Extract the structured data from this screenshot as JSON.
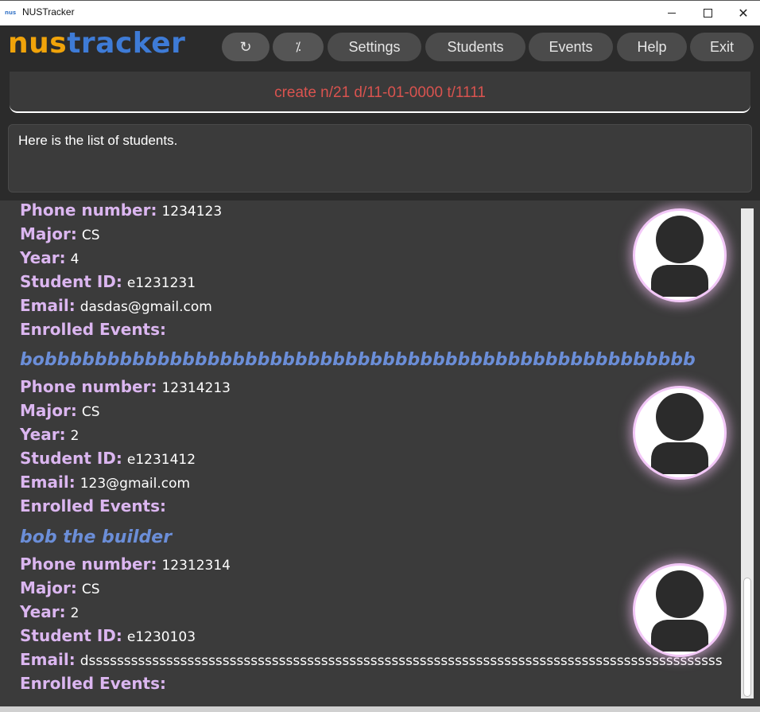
{
  "window": {
    "title": "NUSTracker",
    "icon": "nustracker-app-icon",
    "close_glyph": "✕"
  },
  "header": {
    "logo_part1": "nus",
    "logo_part2": "tracker",
    "buttons": {
      "refresh_icon": "↻",
      "percent_icon": "⁒",
      "settings": "Settings",
      "students": "Students",
      "events": "Events",
      "help": "Help",
      "exit": "Exit"
    }
  },
  "command": {
    "value": "create n/21 d/11-01-0000 t/1111"
  },
  "result": {
    "text": "Here is the list of students."
  },
  "labels": {
    "phone": "Phone number:",
    "major": "Major:",
    "year": "Year:",
    "student_id": "Student ID:",
    "email": "Email:",
    "enrolled_events": "Enrolled Events:"
  },
  "students": [
    {
      "name": "",
      "phone": "1234123",
      "major": "CS",
      "year": "4",
      "student_id": "e1231231",
      "email": "dasdas@gmail.com",
      "enrolled_events": ""
    },
    {
      "name": "bobbbbbbbbbbbbbbbbbbbbbbbbbbbbbbbbbbbbbbbbbbbbbbbbbbbb",
      "phone": "12314213",
      "major": "CS",
      "year": "2",
      "student_id": "e1231412",
      "email": "123@gmail.com",
      "enrolled_events": ""
    },
    {
      "name": "bob the builder",
      "phone": "12312314",
      "major": "CS",
      "year": "2",
      "student_id": "e1230103",
      "email": "dssssssssssssssssssssssssssssssssssssssssssssssssssssssssssssssssssssssssssssssssssssssssss",
      "enrolled_events": ""
    }
  ],
  "colors": {
    "logo_nus": "#f0a30a",
    "logo_tracker": "#3e7bd6",
    "command_text": "#d9534f",
    "student_name": "#6b8ed8",
    "field_label": "#dbb6f0"
  }
}
